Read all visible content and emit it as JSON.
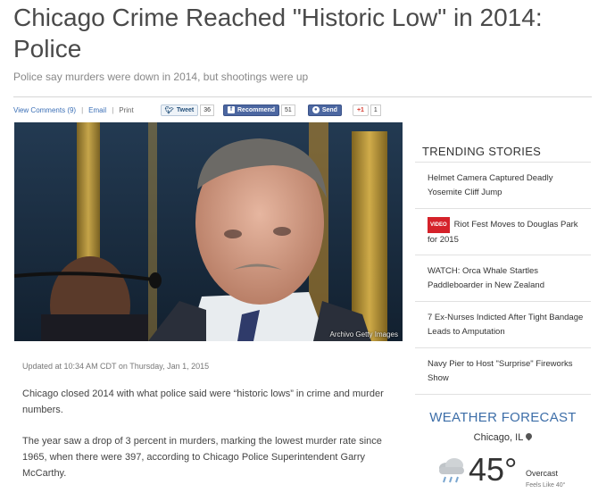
{
  "article": {
    "headline": "Chicago Crime Reached \"Historic Low\" in 2014: Police",
    "subhead": "Police say murders were down in 2014, but shootings were up",
    "updated": "Updated at 10:34 AM CDT on Thursday, Jan 1, 2015",
    "photo_credit": "Archivo Getty Images",
    "paragraphs": [
      "Chicago closed 2014 with what police said were “historic lows” in crime and murder numbers.",
      "The year saw a drop of 3 percent in murders, marking the lowest murder rate since 1965, when there were 397, according to Chicago Police Superintendent Garry McCarthy."
    ]
  },
  "toolbar": {
    "comments": "View Comments (9)",
    "email": "Email",
    "print": "Print",
    "tweet_label": "Tweet",
    "tweet_count": "36",
    "recommend_label": "Recommend",
    "recommend_count": "51",
    "send_label": "Send",
    "gplus_label": "+1",
    "gplus_count": "1"
  },
  "trending": {
    "title": "TRENDING STORIES",
    "video_badge": "VIDEO",
    "items": [
      "Helmet Camera Captured Deadly Yosemite Cliff Jump",
      "Riot Fest Moves to Douglas Park for 2015",
      "WATCH: Orca Whale Startles Paddleboarder in New Zealand",
      "7 Ex-Nurses Indicted After Tight Bandage Leads to Amputation",
      "Navy Pier to Host \"Surprise\" Fireworks Show"
    ]
  },
  "weather": {
    "title": "WEATHER FORECAST",
    "city": "Chicago, IL",
    "temp": "45°",
    "condition": "Overcast",
    "feels": "Feels Like 40°",
    "icon": "cloud-rain-icon"
  },
  "colors": {
    "link": "#3b6fb6",
    "weather_title": "#3d6ea8",
    "video_badge": "#d5222a",
    "facebook": "#4c67a1"
  }
}
